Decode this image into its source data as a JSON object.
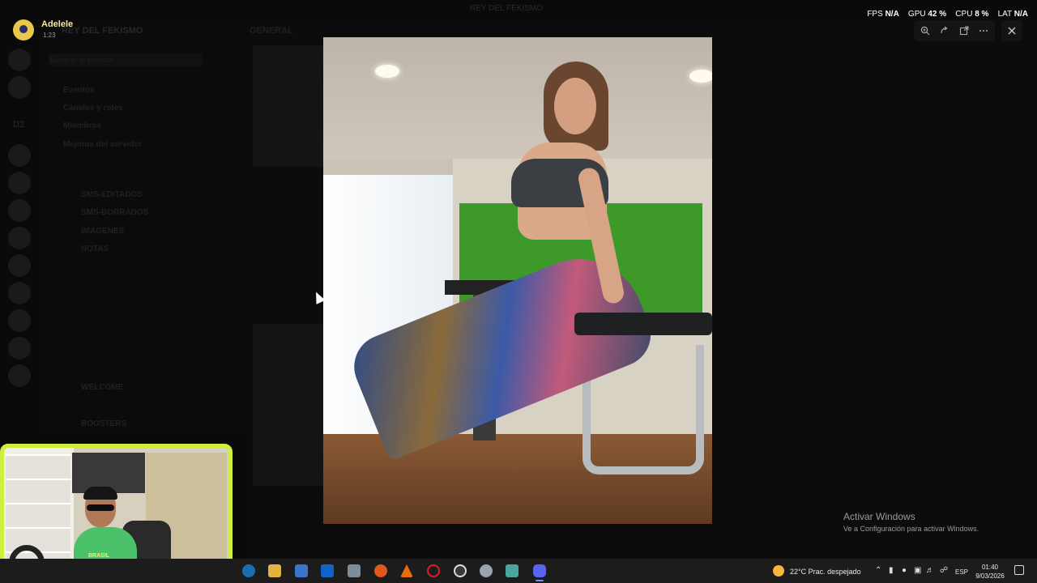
{
  "window": {
    "title": "REY DEL FEKISMO"
  },
  "overlay_stats": {
    "fps_label": "FPS",
    "fps_value": "N/A",
    "gpu_label": "GPU",
    "gpu_value": "42 %",
    "cpu_label": "CPU",
    "cpu_value": "8 %",
    "lat_label": "LAT",
    "lat_value": "N/A"
  },
  "user": {
    "name": "Adelele",
    "sub": "1:23"
  },
  "background_discord": {
    "server_title": "REY DEL FEKISMO",
    "search_placeholder": "Explorar el servidor",
    "channel_header": "GENERAL",
    "server_label": "D2",
    "channels": [
      "Eventos",
      "Canales y roles",
      "Miembros",
      "Mejoras del servidor",
      "SMS-EDITADOS",
      "SMS-BORRADOS",
      "IMAGENES",
      "NOTAS",
      "WELCOME",
      "BOOSTERS"
    ]
  },
  "viewer": {
    "toolbar": [
      "zoom-in",
      "rotate",
      "open-in-browser",
      "more"
    ],
    "close": "close"
  },
  "activation": {
    "title": "Activar Windows",
    "subtitle": "Ve a Configuración para activar Windows."
  },
  "webcam": {
    "shirt_text": "BRASIL"
  },
  "taskbar": {
    "weather": "22°C  Prac. despejado",
    "language": "ESP",
    "time": "01:40",
    "date": "9/03/2026",
    "apps": [
      "edge",
      "file-explorer",
      "store",
      "outlook",
      "notepad",
      "firefox",
      "vlc",
      "opera",
      "obs",
      "settings",
      "notes",
      "discord"
    ]
  }
}
